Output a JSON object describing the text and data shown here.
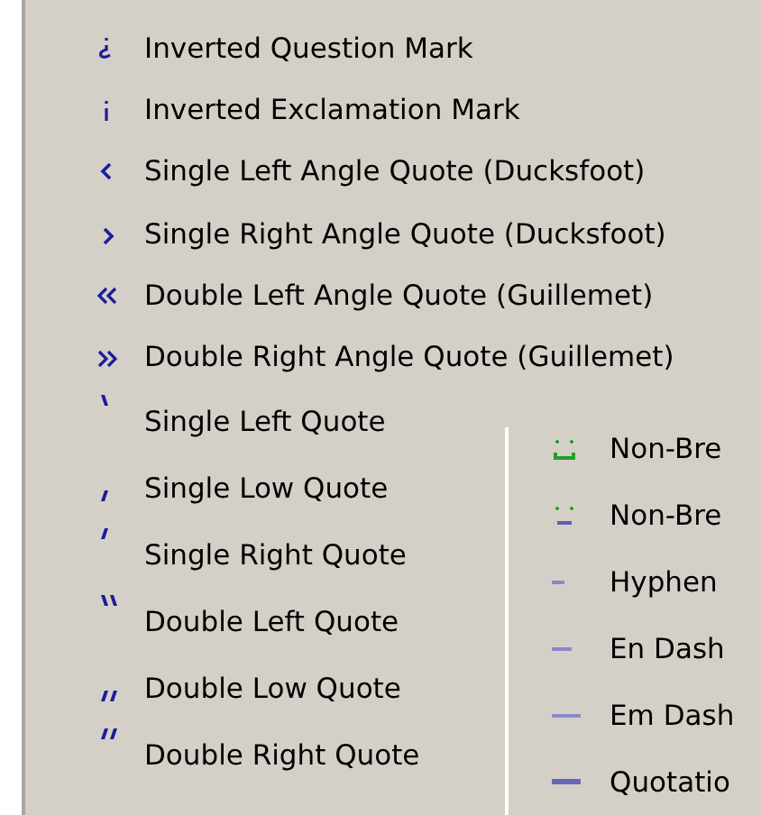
{
  "menu": {
    "items": [
      {
        "kind": "inverted-question",
        "label": "Inverted Question Mark"
      },
      {
        "kind": "inverted-exclamation",
        "label": "Inverted Exclamation Mark"
      },
      {
        "kind": "single-left-angle",
        "label": "Single Left Angle Quote (Ducksfoot)"
      },
      {
        "kind": "single-right-angle",
        "label": "Single Right Angle Quote (Ducksfoot)"
      },
      {
        "kind": "double-left-angle",
        "label": "Double Left Angle Quote (Guillemet)"
      },
      {
        "kind": "double-right-angle",
        "label": "Double Right Angle Quote (Guillemet)"
      }
    ],
    "left_column": [
      {
        "kind": "single-left-quote",
        "label": "Single Left Quote"
      },
      {
        "kind": "single-low-quote",
        "label": "Single Low Quote"
      },
      {
        "kind": "single-right-quote",
        "label": "Single Right Quote"
      },
      {
        "kind": "double-left-quote",
        "label": "Double Left Quote"
      },
      {
        "kind": "double-low-quote",
        "label": "Double Low Quote"
      },
      {
        "kind": "double-right-quote",
        "label": "Double Right Quote"
      }
    ],
    "right_column": [
      {
        "kind": "nb-space",
        "label": "Non-Bre"
      },
      {
        "kind": "nb-hyphen",
        "label": "Non-Bre"
      },
      {
        "kind": "hyphen",
        "label": "Hyphen"
      },
      {
        "kind": "en-dash",
        "label": "En Dash"
      },
      {
        "kind": "em-dash",
        "label": "Em Dash"
      },
      {
        "kind": "bar",
        "label": "Quotatio"
      }
    ]
  }
}
